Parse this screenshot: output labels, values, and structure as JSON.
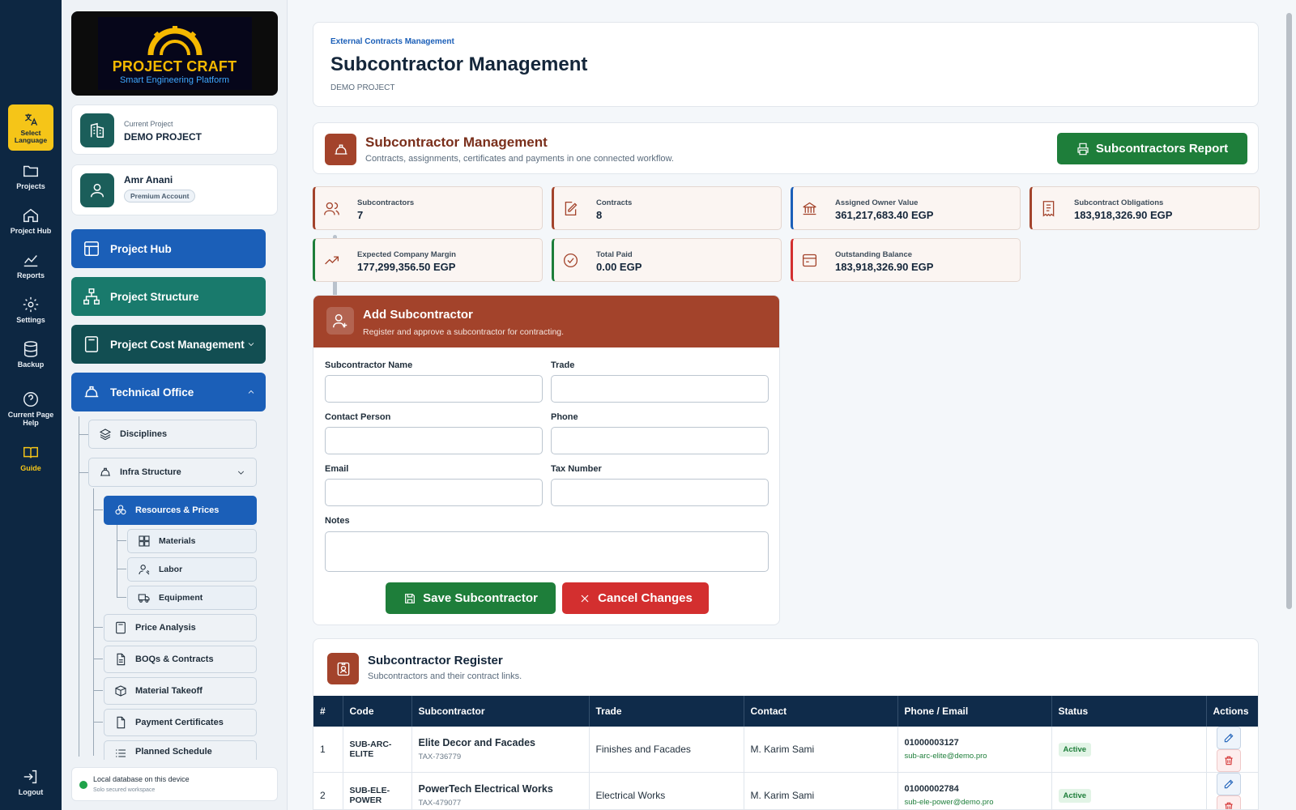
{
  "rail": {
    "language": "Select Language",
    "items": [
      "Projects",
      "Project Hub",
      "Reports",
      "Settings",
      "Backup",
      "Current Page Help",
      "Guide"
    ],
    "logout": "Logout"
  },
  "logo": {
    "title": "PROJECT CRAFT",
    "subtitle": "Smart Engineering Platform"
  },
  "project": {
    "label": "Current Project",
    "name": "DEMO PROJECT"
  },
  "user": {
    "name": "Amr Anani",
    "badge": "Premium Account"
  },
  "nav": {
    "project_hub": "Project Hub",
    "project_structure": "Project Structure",
    "project_cost": "Project Cost Management",
    "technical_office": "Technical Office",
    "disciplines": "Disciplines",
    "infra": "Infra Structure",
    "resources": "Resources & Prices",
    "materials": "Materials",
    "labor": "Labor",
    "equipment": "Equipment",
    "price_analysis": "Price Analysis",
    "boqs": "BOQs & Contracts",
    "takeoff": "Material Takeoff",
    "certificates": "Payment Certificates",
    "schedule": "Planned Schedule"
  },
  "db": {
    "title": "Local database on this device",
    "sub": "Solo secured workspace"
  },
  "header": {
    "breadcrumb": "External Contracts Management",
    "title": "Subcontractor Management",
    "project": "DEMO PROJECT"
  },
  "section": {
    "title": "Subcontractor Management",
    "subtitle": "Contracts, assignments, certificates and payments in one connected workflow.",
    "report_button": "Subcontractors Report"
  },
  "stats": [
    {
      "label": "Subcontractors",
      "value": "7"
    },
    {
      "label": "Contracts",
      "value": "8"
    },
    {
      "label": "Assigned Owner Value",
      "value": "361,217,683.40 EGP"
    },
    {
      "label": "Subcontract Obligations",
      "value": "183,918,326.90 EGP"
    },
    {
      "label": "Expected Company Margin",
      "value": "177,299,356.50 EGP"
    },
    {
      "label": "Total Paid",
      "value": "0.00 EGP"
    },
    {
      "label": "Outstanding Balance",
      "value": "183,918,326.90 EGP"
    }
  ],
  "form": {
    "title": "Add Subcontractor",
    "subtitle": "Register and approve a subcontractor for contracting.",
    "fields": {
      "name": "Subcontractor Name",
      "trade": "Trade",
      "contact": "Contact Person",
      "phone": "Phone",
      "email": "Email",
      "tax": "Tax Number",
      "notes": "Notes"
    },
    "values": {
      "name": "",
      "trade": "",
      "contact": "",
      "phone": "",
      "email": "",
      "tax": "",
      "notes": ""
    },
    "save": "Save Subcontractor",
    "cancel": "Cancel Changes"
  },
  "register": {
    "title": "Subcontractor Register",
    "subtitle": "Subcontractors and their contract links.",
    "columns": [
      "#",
      "Code",
      "Subcontractor",
      "Trade",
      "Contact",
      "Phone / Email",
      "Status",
      "Actions"
    ],
    "rows": [
      {
        "n": "1",
        "code": "SUB-ARC-ELITE",
        "name": "Elite Decor and Facades",
        "tax": "TAX-736779",
        "trade": "Finishes and Facades",
        "contact": "M. Karim Sami",
        "phone": "01000003127",
        "email": "sub-arc-elite@demo.pro",
        "status": "Active"
      },
      {
        "n": "2",
        "code": "SUB-ELE-POWER",
        "name": "PowerTech Electrical Works",
        "tax": "TAX-479077",
        "trade": "Electrical Works",
        "contact": "M. Karim Sami",
        "phone": "01000002784",
        "email": "sub-ele-power@demo.pro",
        "status": "Active"
      }
    ]
  },
  "colors": {
    "navy": "#0d2742",
    "accent_brown": "#a3432b",
    "green": "#1e7e3a",
    "blue": "#1b5fb8",
    "red": "#d32f2f",
    "yellow": "#f5c518"
  }
}
